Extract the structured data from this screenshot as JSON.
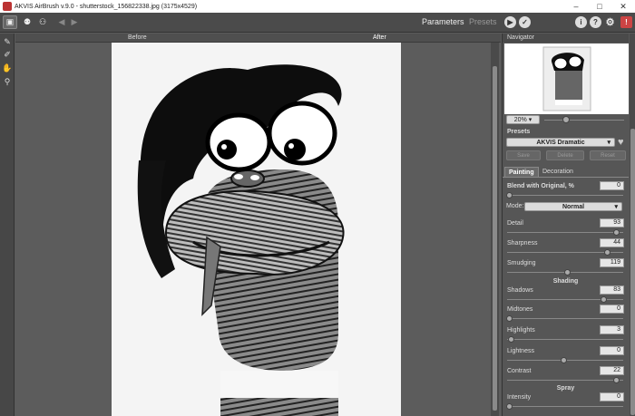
{
  "window": {
    "title": "AKVIS AirBrush v.9.0 - shutterstock_156822338.jpg (3175x4529)",
    "minimize": "–",
    "maximize": "□",
    "close": "✕"
  },
  "toolbar": {
    "tabs": [
      "Parameters",
      "Presets"
    ],
    "icons": [
      "open-image-icon",
      "save-image-icon",
      "print-image-icon",
      "undo-icon",
      "redo-icon",
      "run-icon",
      "apply-icon",
      "info-icon",
      "help-icon",
      "settings-icon",
      "news-icon"
    ]
  },
  "canvas": {
    "before_label": "Before",
    "after_label": "After"
  },
  "tools": [
    "brush-icon",
    "history-brush-icon",
    "hand-icon",
    "zoom-icon"
  ],
  "navigator": {
    "title": "Navigator",
    "zoom": "20%"
  },
  "presets": {
    "title": "Presets",
    "selected": "AKVIS Dramatic",
    "save": "Save",
    "delete": "Delete",
    "reset": "Reset"
  },
  "tabs": {
    "painting": "Painting",
    "decoration": "Decoration"
  },
  "params": {
    "blend_label": "Blend with Original, %",
    "blend_value": "0",
    "mode_label": "Mode:",
    "mode_value": "Normal",
    "detail_label": "Detail",
    "detail_value": "93",
    "sharpness_label": "Sharpness",
    "sharpness_value": "44",
    "smudging_label": "Smudging",
    "smudging_value": "119",
    "shading_title": "Shading",
    "shadows_label": "Shadows",
    "shadows_value": "83",
    "midtones_label": "Midtones",
    "midtones_value": "0",
    "highlights_label": "Highlights",
    "highlights_value": "3",
    "lightness_label": "Lightness",
    "lightness_value": "0",
    "contrast_label": "Contrast",
    "contrast_value": "22",
    "spray_title": "Spray",
    "intensity_label": "Intensity",
    "intensity_value": "0"
  }
}
